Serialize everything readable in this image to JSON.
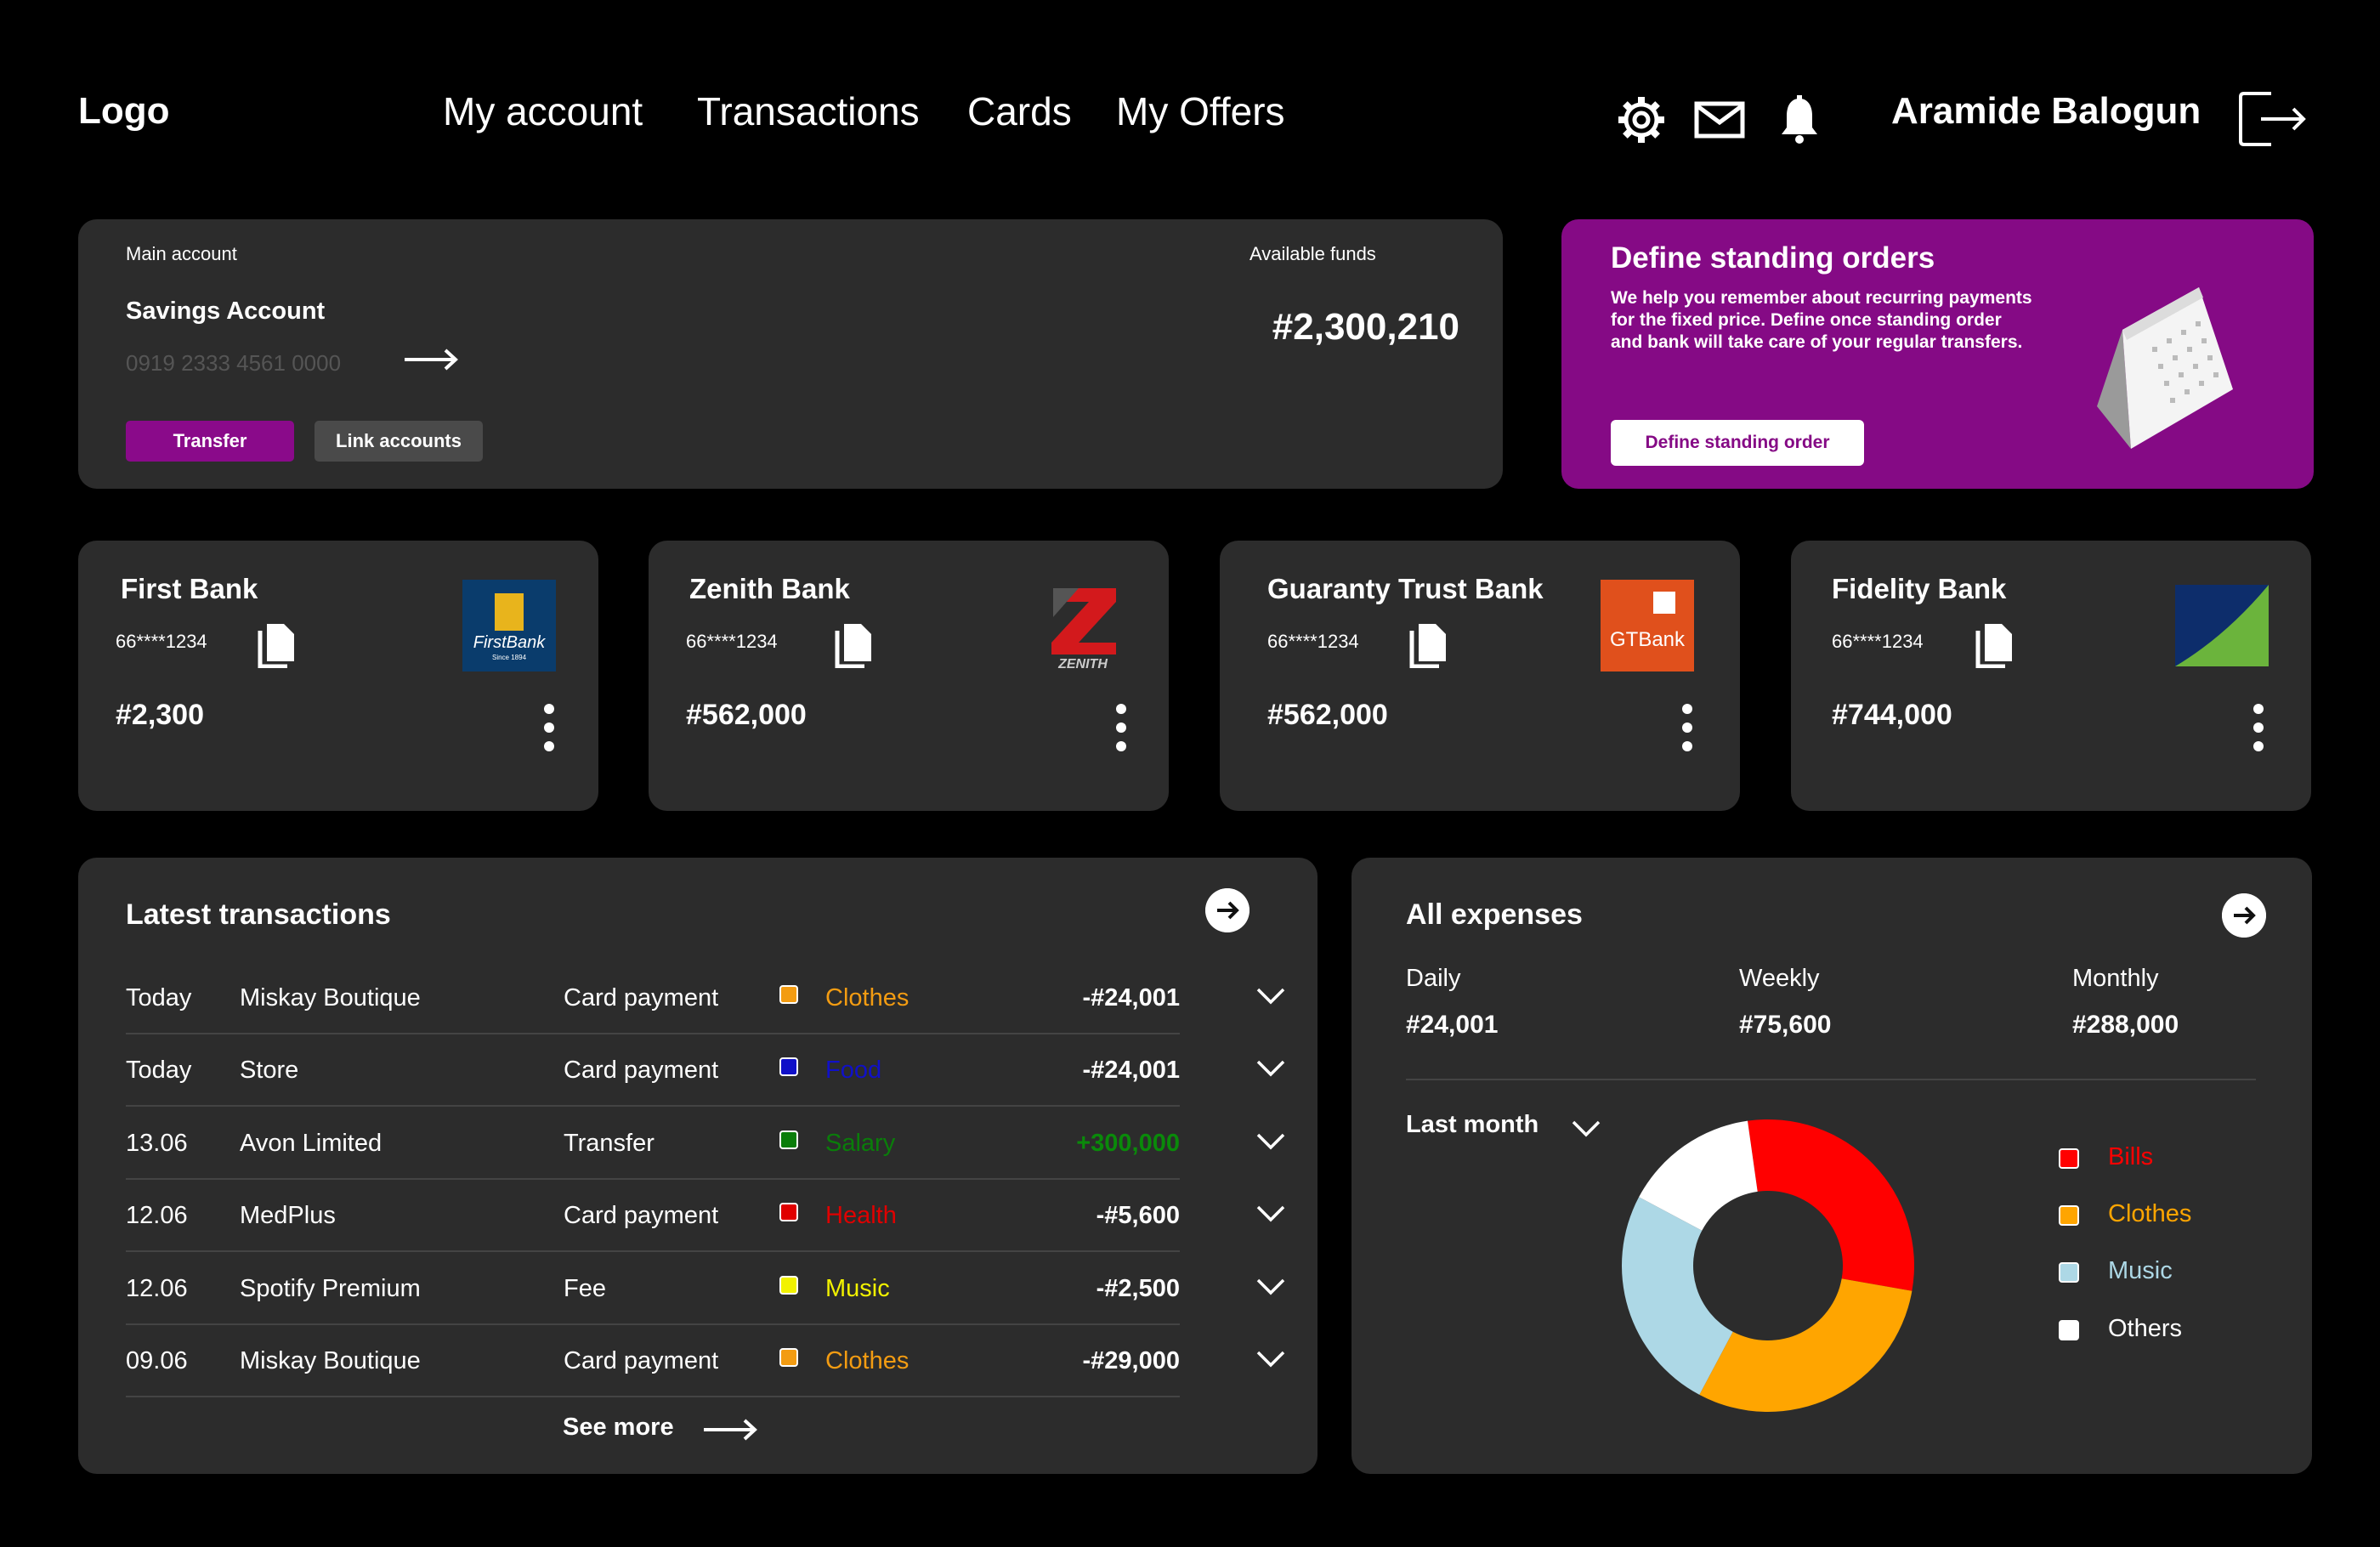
{
  "header": {
    "logo": "Logo",
    "nav": [
      "My account",
      "Transactions",
      "Cards",
      "My Offers"
    ],
    "icons": [
      "settings-gear-icon",
      "mail-icon",
      "bell-icon",
      "logout-icon"
    ],
    "user_name": "Aramide Balogun"
  },
  "main_account": {
    "label": "Main account",
    "account_type": "Savings Account",
    "account_number": "0919 2333 4561 0000",
    "available_label": "Available funds",
    "available_amount": "#2,300,210",
    "transfer_label": "Transfer",
    "link_label": "Link accounts"
  },
  "standing_orders": {
    "title": "Define standing orders",
    "description": "We help you remember about recurring payments for the fixed price. Define once standing order and bank will take care of your regular transfers.",
    "button_label": "Define standing order",
    "illustration": "calendar-icon"
  },
  "banks": [
    {
      "name": "First Bank",
      "account": "66****1234",
      "balance": "#2,300",
      "logo_text": "FirstBank",
      "logo_subtext": "Since 1894"
    },
    {
      "name": "Zenith Bank",
      "account": "66****1234",
      "balance": "#562,000",
      "logo_text": "ZENITH"
    },
    {
      "name": "Guaranty Trust Bank",
      "account": "66****1234",
      "balance": "#562,000",
      "logo_text": "GTBank"
    },
    {
      "name": "Fidelity Bank",
      "account": "66****1234",
      "balance": "#744,000"
    }
  ],
  "transactions": {
    "title": "Latest transactions",
    "rows": [
      {
        "date": "Today",
        "merchant": "Miskay Boutique",
        "type": "Card payment",
        "category": "Clothes",
        "category_color": "#f39c12",
        "amount": "-#24,001",
        "amount_color": "#ffffff"
      },
      {
        "date": "Today",
        "merchant": "Store",
        "type": "Card payment",
        "category": "Food",
        "category_color": "#1010c8",
        "amount": "-#24,001",
        "amount_color": "#ffffff"
      },
      {
        "date": "13.06",
        "merchant": "Avon Limited",
        "type": "Transfer",
        "category": "Salary",
        "category_color": "#0a7d0a",
        "amount": "+300,000",
        "amount_color": "#0a8a0a"
      },
      {
        "date": "12.06",
        "merchant": "MedPlus",
        "type": "Card payment",
        "category": "Health",
        "category_color": "#e00000",
        "amount": "-#5,600",
        "amount_color": "#ffffff"
      },
      {
        "date": "12.06",
        "merchant": "Spotify Premium",
        "type": "Fee",
        "category": "Music",
        "category_color": "#f2f200",
        "amount": "-#2,500",
        "amount_color": "#ffffff"
      },
      {
        "date": "09.06",
        "merchant": "Miskay Boutique",
        "type": "Card payment",
        "category": "Clothes",
        "category_color": "#f39c12",
        "amount": "-#29,000",
        "amount_color": "#ffffff"
      }
    ],
    "see_more": "See more"
  },
  "expenses": {
    "title": "All expenses",
    "daily_label": "Daily",
    "daily_value": "#24,001",
    "weekly_label": "Weekly",
    "weekly_value": "#75,600",
    "monthly_label": "Monthly",
    "monthly_value": "#288,000",
    "period": "Last month",
    "chart_data": {
      "type": "pie",
      "categories": [
        "Bills",
        "Clothes",
        "Music",
        "Others"
      ],
      "values": [
        30,
        30,
        25,
        15
      ],
      "colors": [
        "#ff0000",
        "#ffa500",
        "#add8e6",
        "#ffffff"
      ]
    }
  }
}
